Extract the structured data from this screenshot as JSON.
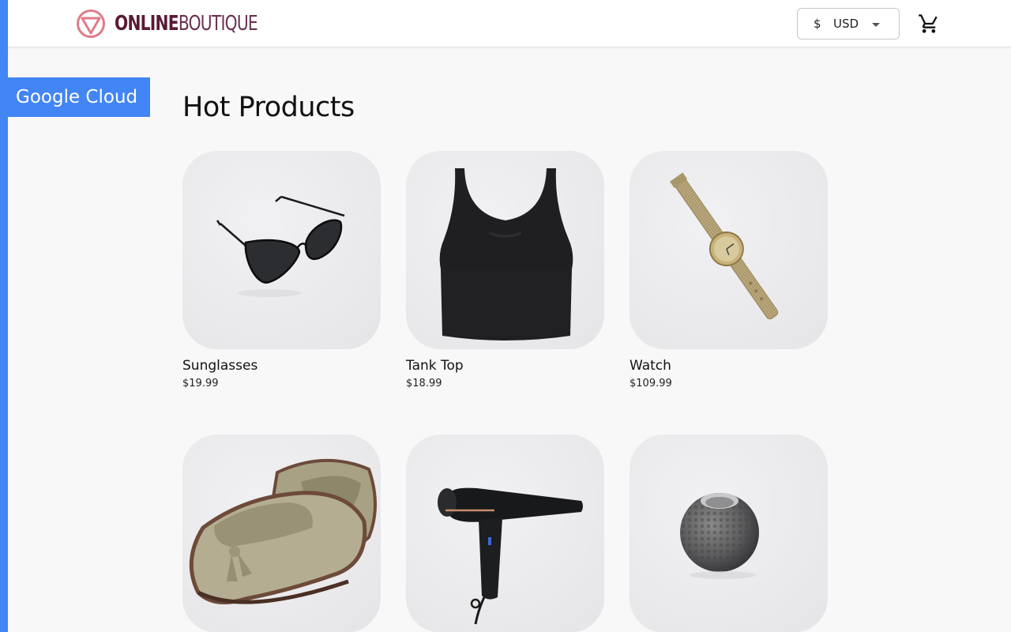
{
  "brand": {
    "name_bold": "ONLINE",
    "name_thin": "BOUTIQUE"
  },
  "header": {
    "currency_symbol": "$",
    "currency_code": "USD",
    "cart_icon": "shopping-cart-icon"
  },
  "badge": {
    "label": "Google Cloud"
  },
  "main": {
    "title": "Hot Products",
    "products": [
      {
        "name": "Sunglasses",
        "price": "$19.99",
        "icon": "sunglasses-image"
      },
      {
        "name": "Tank Top",
        "price": "$18.99",
        "icon": "tank-top-image"
      },
      {
        "name": "Watch",
        "price": "$109.99",
        "icon": "watch-image"
      },
      {
        "name": "",
        "price": "",
        "icon": "loafers-image"
      },
      {
        "name": "",
        "price": "",
        "icon": "hair-dryer-image"
      },
      {
        "name": "",
        "price": "",
        "icon": "candle-holder-image"
      }
    ]
  },
  "colors": {
    "accent_blue": "#4285f4",
    "brand_maroon": "#5a1a36",
    "logo_pink": "#e07c88",
    "page_bg": "#f8f8f8"
  }
}
